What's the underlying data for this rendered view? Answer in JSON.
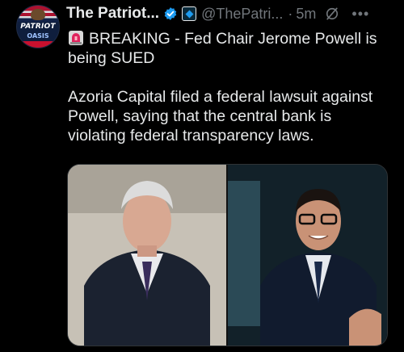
{
  "account": {
    "name": "The Patriot...",
    "handle": "@ThePatri...",
    "separator": "·",
    "time": "5m",
    "avatar_text_top": "PATRIOT",
    "avatar_text_bottom": "OASIS"
  },
  "post": {
    "line1": "BREAKING - Fed Chair Jerome Powell is",
    "line2": "being SUED",
    "line3": "Azoria Capital filed a federal lawsuit against",
    "line4": "Powell, saying that the central bank is",
    "line5": "violating federal transparency laws."
  },
  "icons": {
    "verified": "verified-badge-icon",
    "affiliate": "affiliate-badge-icon",
    "grok": "grok-icon",
    "more": "more-icon",
    "siren": "siren-emoji-icon"
  },
  "colors": {
    "background": "#000000",
    "text": "#e7e9ea",
    "muted": "#71767b",
    "accent": "#1d9bf0"
  }
}
